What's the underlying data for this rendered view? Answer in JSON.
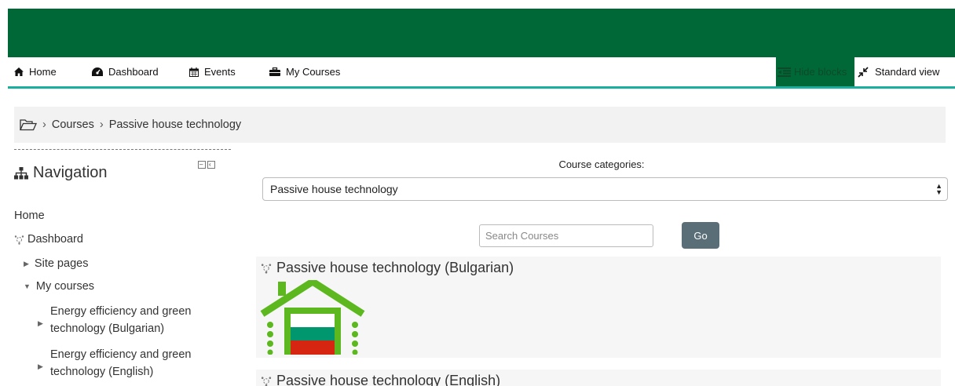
{
  "navbar": {
    "items": [
      {
        "label": "Home",
        "icon": "home-icon"
      },
      {
        "label": "Dashboard",
        "icon": "tachometer-icon"
      },
      {
        "label": "Events",
        "icon": "calendar-icon"
      },
      {
        "label": "My Courses",
        "icon": "briefcase-icon"
      }
    ],
    "hide_blocks": "Hide blocks",
    "standard_view": "Standard view"
  },
  "breadcrumb": {
    "items": [
      "Courses",
      "Passive house technology"
    ]
  },
  "navigation_block": {
    "title": "Navigation",
    "home": "Home",
    "dashboard": "Dashboard",
    "site_pages": "Site pages",
    "my_courses": "My courses",
    "courses": [
      {
        "line1": "Energy efficiency and green",
        "line2": "technology (Bulgarian)"
      },
      {
        "line1": "Energy efficiency and green",
        "line2": "technology (English)"
      }
    ]
  },
  "main": {
    "category_label": "Course categories:",
    "category_selected": "Passive house technology",
    "search_placeholder": "Search Courses",
    "go_label": "Go",
    "courses": [
      {
        "title": "Passive house technology (Bulgarian)"
      },
      {
        "title": "Passive house technology (English)"
      }
    ]
  },
  "colors": {
    "brand_green": "#006837",
    "accent_teal": "#1aae9f",
    "house_green": "#5cb81e",
    "flag_white": "#ffffff",
    "flag_green": "#00966e",
    "flag_red": "#d62612"
  }
}
